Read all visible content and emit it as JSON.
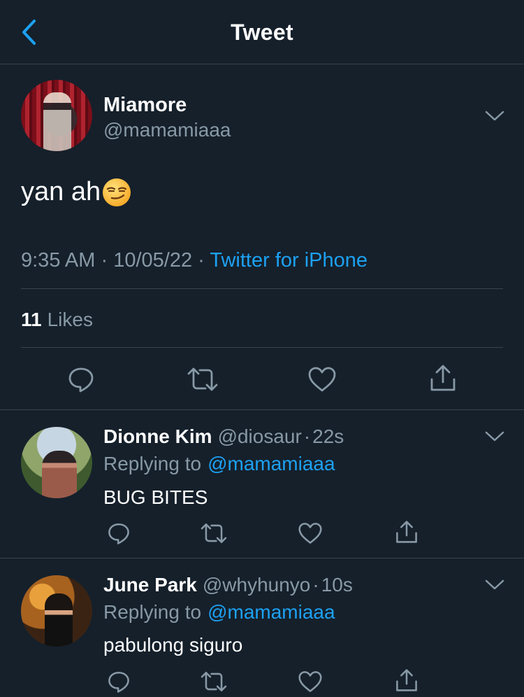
{
  "header": {
    "title": "Tweet",
    "back_icon": "chevron-left-icon"
  },
  "colors": {
    "background": "#15202b",
    "accent": "#1da1f2",
    "muted": "#8899a6",
    "divider": "#38444d"
  },
  "main_tweet": {
    "display_name": "Miamore",
    "handle": "@mamamiaaa",
    "text": "yan ah",
    "emoji": "smirking-face-emoji",
    "time": "9:35 AM",
    "separator": "·",
    "date": "10/05/22",
    "source": "Twitter for iPhone",
    "likes_count": "11",
    "likes_label": "Likes"
  },
  "replies": [
    {
      "display_name": "Dionne Kim",
      "handle": "@diosaur",
      "separator": "·",
      "time": "22s",
      "replying_label": "Replying to",
      "replying_to": "@mamamiaaa",
      "text": "BUG BITES"
    },
    {
      "display_name": "June Park",
      "handle": "@whyhunyo",
      "separator": "·",
      "time": "10s",
      "replying_label": "Replying to",
      "replying_to": "@mamamiaaa",
      "text": "pabulong siguro"
    }
  ],
  "actions": [
    "reply-icon",
    "retweet-icon",
    "like-icon",
    "share-icon"
  ]
}
